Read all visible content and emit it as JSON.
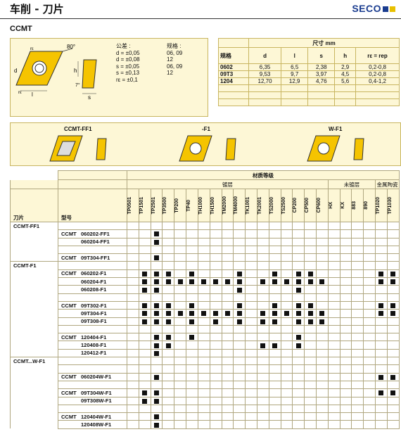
{
  "header": {
    "title": "车削 - 刀片",
    "logo": "SECO"
  },
  "code": "CCMT",
  "spec": {
    "tol_title": "公差 :",
    "tols": [
      "d = ±0,05",
      "d = ±0,08",
      "s = ±0,05",
      "s = ±0,13",
      "rε = ±0,1"
    ],
    "std_title": "规格 :",
    "stds": [
      "06, 09",
      "12",
      "06, 09",
      "12"
    ],
    "angle": "80°",
    "labels": {
      "d": "d",
      "l": "l",
      "h": "h",
      "s": "s",
      "r": "rε",
      "angle7": "7°"
    }
  },
  "dims": {
    "group_header": "尺寸 mm",
    "col_headers": [
      "规格",
      "d",
      "l",
      "s",
      "h",
      "rε = rep"
    ],
    "rows": [
      [
        "0602",
        "6,35",
        "6,5",
        "2,38",
        "2,9",
        "0,2-0,8"
      ],
      [
        "09T3",
        "9,53",
        "9,7",
        "3,97",
        "4,5",
        "0,2-0,8"
      ],
      [
        "1204",
        "12,70",
        "12,9",
        "4,76",
        "5,6",
        "0,4-1,2"
      ]
    ]
  },
  "chipbreakers": [
    "CCMT-FF1",
    "-F1",
    "W-F1"
  ],
  "grades": {
    "title": "材质等级",
    "groups": [
      "镀层",
      "未镀层",
      "金属陶瓷"
    ],
    "col_insert": "刀片",
    "col_type": "型号",
    "names": [
      "TP0501",
      "TP1501",
      "TP2501",
      "TP3500",
      "TP200",
      "TP40",
      "TH1000",
      "TH1500",
      "TM2000",
      "TM4000",
      "TK1001",
      "TK2001",
      "TS2000",
      "TS2500",
      "CP200",
      "CP500",
      "CP600",
      "HX",
      "KX",
      "883",
      "890",
      "TP1020",
      "TP1030"
    ]
  },
  "sections": [
    {
      "label": "CCMT-FF1",
      "rows": [
        {
          "prefix": "CCMT",
          "code": "060202-FF1",
          "dots": [
            2
          ]
        },
        {
          "prefix": "",
          "code": "060204-FF1",
          "dots": [
            2
          ]
        },
        {
          "prefix": "",
          "code": "",
          "dots": []
        },
        {
          "prefix": "CCMT",
          "code": "09T304-FF1",
          "dots": [
            2
          ]
        }
      ]
    },
    {
      "label": "CCMT-F1",
      "rows": [
        {
          "prefix": "CCMT",
          "code": "060202-F1",
          "dots": [
            1,
            2,
            3,
            5,
            9,
            12,
            14,
            15,
            21,
            22
          ]
        },
        {
          "prefix": "",
          "code": "060204-F1",
          "dots": [
            1,
            2,
            3,
            4,
            5,
            6,
            7,
            8,
            9,
            11,
            12,
            13,
            14,
            15,
            16,
            21,
            22
          ]
        },
        {
          "prefix": "",
          "code": "060208-F1",
          "dots": [
            1,
            2,
            9,
            14
          ]
        },
        {
          "prefix": "",
          "code": "",
          "dots": []
        },
        {
          "prefix": "CCMT",
          "code": "09T302-F1",
          "dots": [
            1,
            2,
            3,
            5,
            9,
            12,
            14,
            15,
            21,
            22
          ]
        },
        {
          "prefix": "",
          "code": "09T304-F1",
          "dots": [
            1,
            2,
            3,
            4,
            5,
            6,
            7,
            8,
            9,
            11,
            12,
            13,
            14,
            15,
            16,
            21,
            22
          ]
        },
        {
          "prefix": "",
          "code": "09T308-F1",
          "dots": [
            1,
            2,
            3,
            5,
            7,
            9,
            11,
            12,
            14,
            15,
            16
          ]
        },
        {
          "prefix": "",
          "code": "",
          "dots": []
        },
        {
          "prefix": "CCMT",
          "code": "120404-F1",
          "dots": [
            2,
            3,
            5,
            14
          ]
        },
        {
          "prefix": "",
          "code": "120408-F1",
          "dots": [
            2,
            3,
            11,
            12,
            14
          ]
        },
        {
          "prefix": "",
          "code": "120412-F1",
          "dots": [
            2
          ]
        }
      ]
    },
    {
      "label": "CCMT...W-F1",
      "rows": [
        {
          "prefix": "",
          "code": "",
          "dots": []
        },
        {
          "prefix": "CCMT",
          "code": "060204W-F1",
          "dots": [
            2,
            21,
            22
          ]
        },
        {
          "prefix": "",
          "code": "",
          "dots": []
        },
        {
          "prefix": "CCMT",
          "code": "09T304W-F1",
          "dots": [
            1,
            2,
            21,
            22
          ]
        },
        {
          "prefix": "",
          "code": "09T308W-F1",
          "dots": [
            1,
            2
          ]
        },
        {
          "prefix": "",
          "code": "",
          "dots": []
        },
        {
          "prefix": "CCMT",
          "code": "120404W-F1",
          "dots": [
            2
          ]
        },
        {
          "prefix": "",
          "code": "120408W-F1",
          "dots": [
            2
          ]
        }
      ]
    }
  ]
}
